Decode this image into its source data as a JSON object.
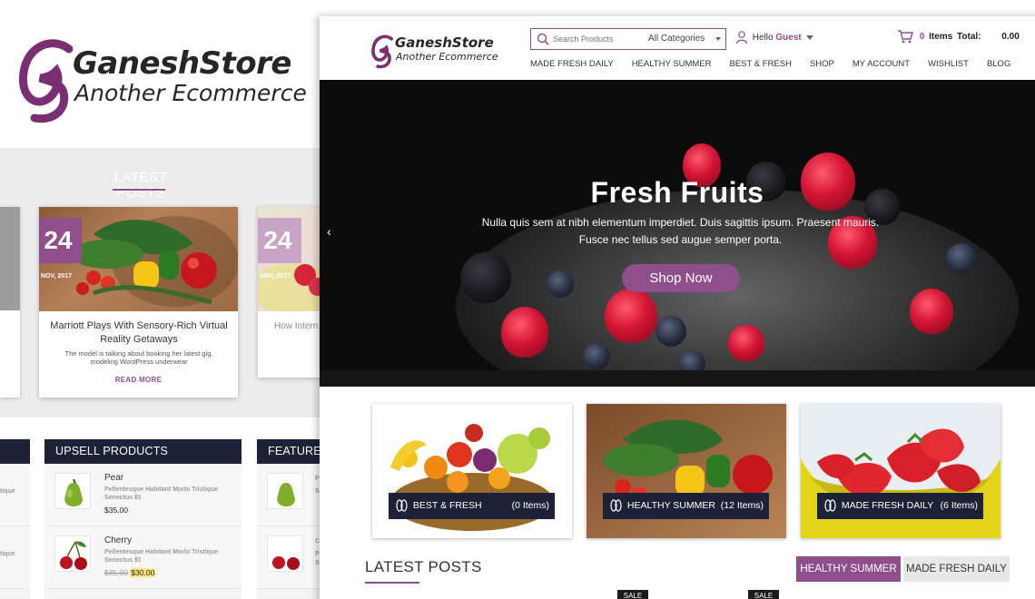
{
  "brand": {
    "name": "GaneshStore",
    "tagline": "Another Ecommerce",
    "accent": "#8e4f8c",
    "dark": "#1e2238"
  },
  "background_page": {
    "latest_posts_heading": "LATEST POSTS",
    "posts": [
      {
        "day": "24",
        "month": "NOV, 2017",
        "title": "Marriott Plays With Sensory-Rich Virtual Reality Getaways",
        "excerpt": "The model is talking about booking her latest gig, modeling WordPress underwear",
        "read_more": "READ MORE"
      },
      {
        "day": "24",
        "month": "NOV, 2017",
        "title": "How Intern"
      }
    ],
    "upsell_heading": "UPSELL PRODUCTS",
    "featured_heading": "FEATURED",
    "left_edge_snippets": [
      "tique",
      "tique"
    ],
    "right_col_desc": [
      "Pe",
      "Se",
      "Ch",
      "Pe",
      "Se"
    ],
    "products": [
      {
        "name": "Pear",
        "description": "Pellentesque Habitant Morbi Tristique Senectus Et",
        "price": "$35.00"
      },
      {
        "name": "Cherry",
        "description": "Pellentesque Habitant Morbi Tristique Senectus Et",
        "old_price": "$35.00",
        "price": "$30.00"
      }
    ]
  },
  "header": {
    "search_placeholder": "Search Products",
    "category_select": "All Categories",
    "hello": "Hello",
    "user": "Guest",
    "cart_count": "0",
    "cart_items_label": "Items",
    "cart_total_label": "Total:",
    "cart_total": "0.00"
  },
  "nav": [
    "MADE FRESH DAILY",
    "HEALTHY SUMMER",
    "BEST & FRESH",
    "SHOP",
    "MY ACCOUNT",
    "WISHLIST",
    "BLOG"
  ],
  "hero": {
    "title": "Fresh Fruits",
    "subtitle_line1": "Nulla quis sem at nibh elementum imperdiet. Duis sagittis ipsum. Praesent mauris.",
    "subtitle_line2": "Fusce nec tellus sed augue semper porta.",
    "button": "Shop Now",
    "prev_arrow": "‹"
  },
  "categories": [
    {
      "label": "BEST & FRESH",
      "count": "(0 Items)"
    },
    {
      "label": "HEALTHY SUMMER",
      "count": "(12 Items)"
    },
    {
      "label": "MADE FRESH DAILY",
      "count": "(6 Items)"
    }
  ],
  "latest_posts": {
    "heading": "LATEST POSTS",
    "tabs": [
      "HEALTHY SUMMER",
      "MADE FRESH DAILY"
    ],
    "sale_badge": "SALE"
  }
}
